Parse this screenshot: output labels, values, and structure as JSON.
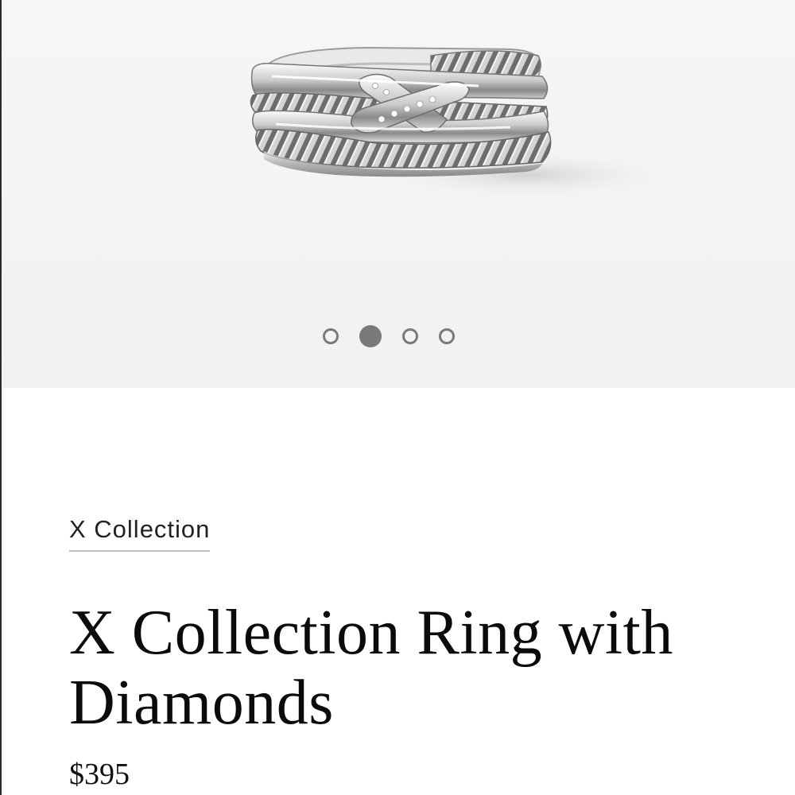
{
  "gallery": {
    "image_icon": "silver-ring-image",
    "slide_count": 4,
    "active_index": 1
  },
  "product": {
    "collection_label": "X Collection",
    "title": "X Collection Ring with Diamonds",
    "price": "$395"
  },
  "colors": {
    "gallery_background": "#f3f3f3",
    "dot": "#7a7a7a",
    "text": "#111111",
    "link_underline": "#bdbdbd"
  }
}
